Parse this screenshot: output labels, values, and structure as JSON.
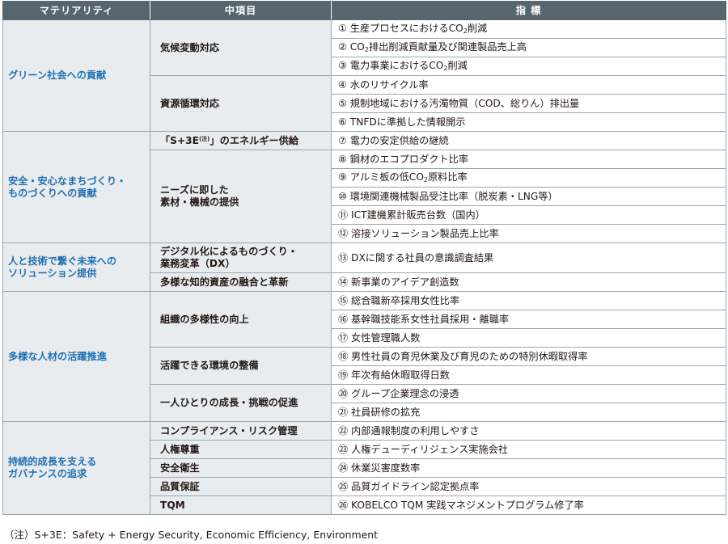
{
  "header": {
    "col1": "マテリアリティ",
    "col2": "中項目",
    "col3": "指 標"
  },
  "rows": {
    "m1": "グリーン社会への貢献",
    "m1_mid1": "気候変動対応",
    "m1_mid2": "資源循環対応",
    "i1a": "① 生産プロセスにおけるCO",
    "i1b": "2",
    "i1c": "削減",
    "i2a": "② CO",
    "i2b": "2",
    "i2c": "排出削減貢献量及び関連製品売上高",
    "i3a": "③ 電力事業におけるCO",
    "i3b": "2",
    "i3c": "削減",
    "i4": "④ 水のリサイクル率",
    "i5": "⑤ 規制地域における汚濁物質（COD、総りん）排出量",
    "i6": "⑥ TNFDに準拠した情報開示",
    "m2_l1": "安全・安心なまちづくり・",
    "m2_l2": "ものづくりへの貢献",
    "m2_mid1a": "「S+3E",
    "m2_mid1b": "(注)",
    "m2_mid1c": "」のエネルギー供給",
    "m2_mid2_l1": "ニーズに即した",
    "m2_mid2_l2": "素材・機械の提供",
    "i7": "⑦ 電力の安定供給の継続",
    "i8": "⑧ 鋼材のエコプロダクト比率",
    "i9a": "⑨ アルミ板の低CO",
    "i9b": "2",
    "i9c": "原料比率",
    "i10": "⑩ 環境関連機械製品受注比率（脱炭素・LNG等）",
    "i11": "⑪ ICT建機累計販売台数（国内）",
    "i12": "⑫ 溶接ソリューション製品売上比率",
    "m3_l1": "人と技術で繋ぐ未来への",
    "m3_l2": "ソリューション提供",
    "m3_mid1_l1": "デジタル化によるものづくり・",
    "m3_mid1_l2": "業務変革（DX）",
    "m3_mid2": "多様な知的資産の融合と革新",
    "i13": "⑬ DXに関する社員の意識調査結果",
    "i14": "⑭ 新事業のアイデア創造数",
    "m4": "多様な人材の活躍推進",
    "m4_mid1": "組織の多様性の向上",
    "m4_mid2": "活躍できる環境の整備",
    "m4_mid3": "一人ひとりの成長・挑戦の促進",
    "i15": "⑮ 総合職新卒採用女性比率",
    "i16": "⑯ 基幹職技能系女性社員採用・離職率",
    "i17": "⑰ 女性管理職人数",
    "i18": "⑱ 男性社員の育児休業及び育児のための特別休暇取得率",
    "i19": "⑲ 年次有給休暇取得日数",
    "i20": "⑳ グループ企業理念の浸透",
    "i21": "㉑ 社員研修の拡充",
    "m5_l1": "持続的成長を支える",
    "m5_l2": "ガバナンスの追求",
    "m5_mid1": "コンプライアンス・リスク管理",
    "m5_mid2": "人権尊重",
    "m5_mid3": "安全衛生",
    "m5_mid4": "品質保証",
    "m5_mid5": "TQM",
    "i22": "㉒ 内部通報制度の利用しやすさ",
    "i23": "㉓ 人権デューディリジェンス実施会社",
    "i24": "㉔ 休業災害度数率",
    "i25": "㉕ 品質ガイドライン認定拠点率",
    "i26": "㉖ KOBELCO TQM 実践マネジメントプログラム修了率"
  },
  "footnote": "（注）S+3E：Safety + Energy Security, Economic Efficiency, Environment",
  "colors": {
    "header_bg": "#57656f",
    "category_bg": "#e9ecee",
    "materiality_text": "#1f6fb3",
    "border": "#9aa6ad"
  }
}
